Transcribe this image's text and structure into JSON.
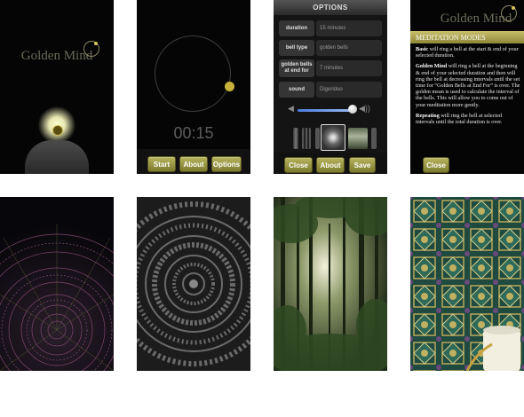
{
  "panel1": {
    "brand": "Golden Mind"
  },
  "panel2": {
    "timer": "00:15",
    "buttons": {
      "start": "Start",
      "about": "About",
      "options": "Options"
    }
  },
  "panel3": {
    "title": "OPTIONS",
    "rows": [
      {
        "label": "duration",
        "value": "15 minutes"
      },
      {
        "label": "bell type",
        "value": "golden bells"
      },
      {
        "label": "golden bells at end for",
        "value": "7 minutes"
      },
      {
        "label": "sound",
        "value": "Digeridoo"
      }
    ],
    "volume_level": 0.9,
    "buttons": {
      "close": "Close",
      "about": "About",
      "save": "Save"
    }
  },
  "panel4": {
    "brand": "Golden Mind",
    "heading": "MEDITATION MODES",
    "modes": [
      {
        "name": "Basic",
        "desc": " will ring a bell at the start & end of your selected duration."
      },
      {
        "name": "Golden Mind",
        "desc": " will ring a bell at the beginning & end of your selected duration and then will ring the bell at decreasing intervals until the set time for “Golden Bells at End For” is over. The golden mean is used to calculate the interval of the bells. This will allow you to come out of your meditation more gently."
      },
      {
        "name": "Repeating",
        "desc": " will ring the bell at selected intervals until the total duration is over."
      }
    ],
    "close": "Close"
  },
  "colors": {
    "accent_gold": "#b7b45c",
    "background": "#050505",
    "slider_blue": "#4c7de0"
  }
}
